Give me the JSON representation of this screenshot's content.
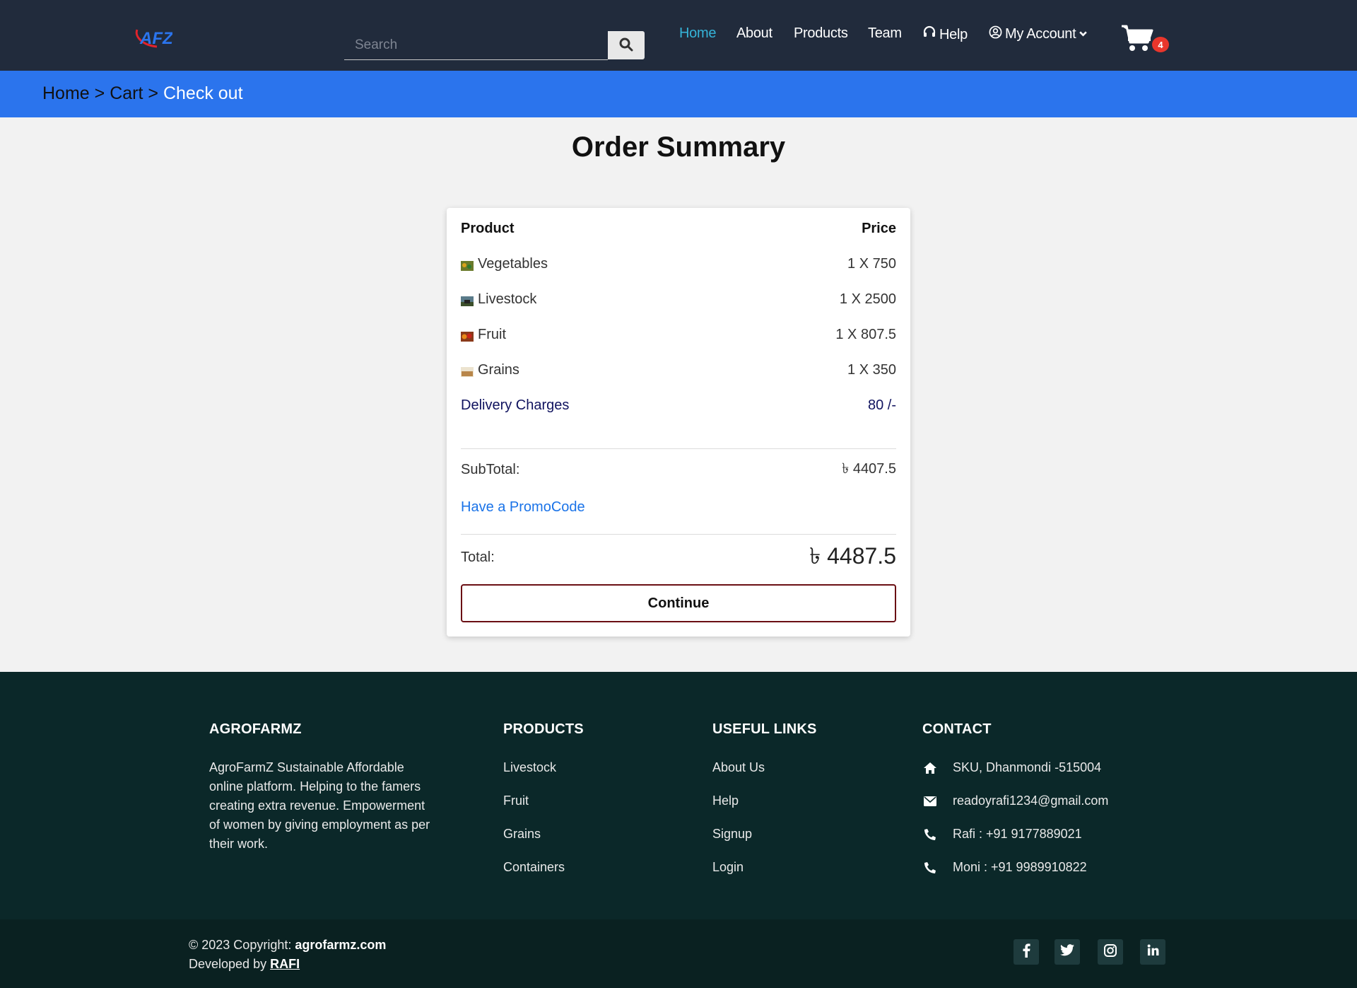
{
  "header": {
    "logo_text": "AFZ",
    "search_placeholder": "Search",
    "nav": [
      "Home",
      "About",
      "Products",
      "Team",
      "Help",
      "My Account"
    ],
    "cart_count": "4"
  },
  "breadcrumb": {
    "home": "Home",
    "sep1": ">",
    "cart": "Cart",
    "sep2": ">",
    "current": "Check out"
  },
  "main": {
    "title": "Order Summary",
    "col_product": "Product",
    "col_price": "Price",
    "items": [
      {
        "name": "Vegetables",
        "price": "1 X 750"
      },
      {
        "name": "Livestock",
        "price": "1 X 2500"
      },
      {
        "name": "Fruit",
        "price": "1 X 807.5"
      },
      {
        "name": "Grains",
        "price": "1 X 350"
      }
    ],
    "delivery_label": "Delivery Charges",
    "delivery_value": "80 /-",
    "subtotal_label": "SubTotal:",
    "subtotal_value": "৳ 4407.5",
    "promo": "Have a PromoCode",
    "total_label": "Total:",
    "total_value": "৳ 4487.5",
    "continue": "Continue"
  },
  "footer": {
    "brand_title": "AGROFARMZ",
    "brand_desc": "AgroFarmZ Sustainable Affordable online platform. Helping to the famers creating extra revenue. Empowerment of women by giving employment as per their work.",
    "products_title": "PRODUCTS",
    "products": [
      "Livestock",
      "Fruit",
      "Grains",
      "Containers"
    ],
    "links_title": "USEFUL LINKS",
    "links": [
      "About Us",
      "Help",
      "Signup",
      "Login"
    ],
    "contact_title": "CONTACT",
    "contact": {
      "address": "SKU, Dhanmondi -515004",
      "email": "readoyrafi1234@gmail.com",
      "phone1": "Rafi : +91 9177889021",
      "phone2": "Moni : +91 9989910822"
    },
    "copyright_prefix": "© 2023 Copyright:",
    "copyright_site": "agrofarmz.com",
    "developed_prefix": "Developed by",
    "developer": "RAFI"
  },
  "icons": {
    "search": "search-icon",
    "help": "headset-icon",
    "account": "user-circle-icon",
    "dropdown": "chevron-down-icon",
    "cart": "shopping-cart-icon",
    "social": [
      "facebook-icon",
      "twitter-icon",
      "instagram-icon",
      "linkedin-icon"
    ]
  },
  "colors": {
    "header_bg": "#212b3c",
    "nav_active": "#35b3d8",
    "breadcrumb_bg": "#2b74ed",
    "footer_bg": "#0b2829",
    "promo_link": "#1a73e8",
    "badge": "#e9362c",
    "continue_border": "#6a0f14"
  }
}
